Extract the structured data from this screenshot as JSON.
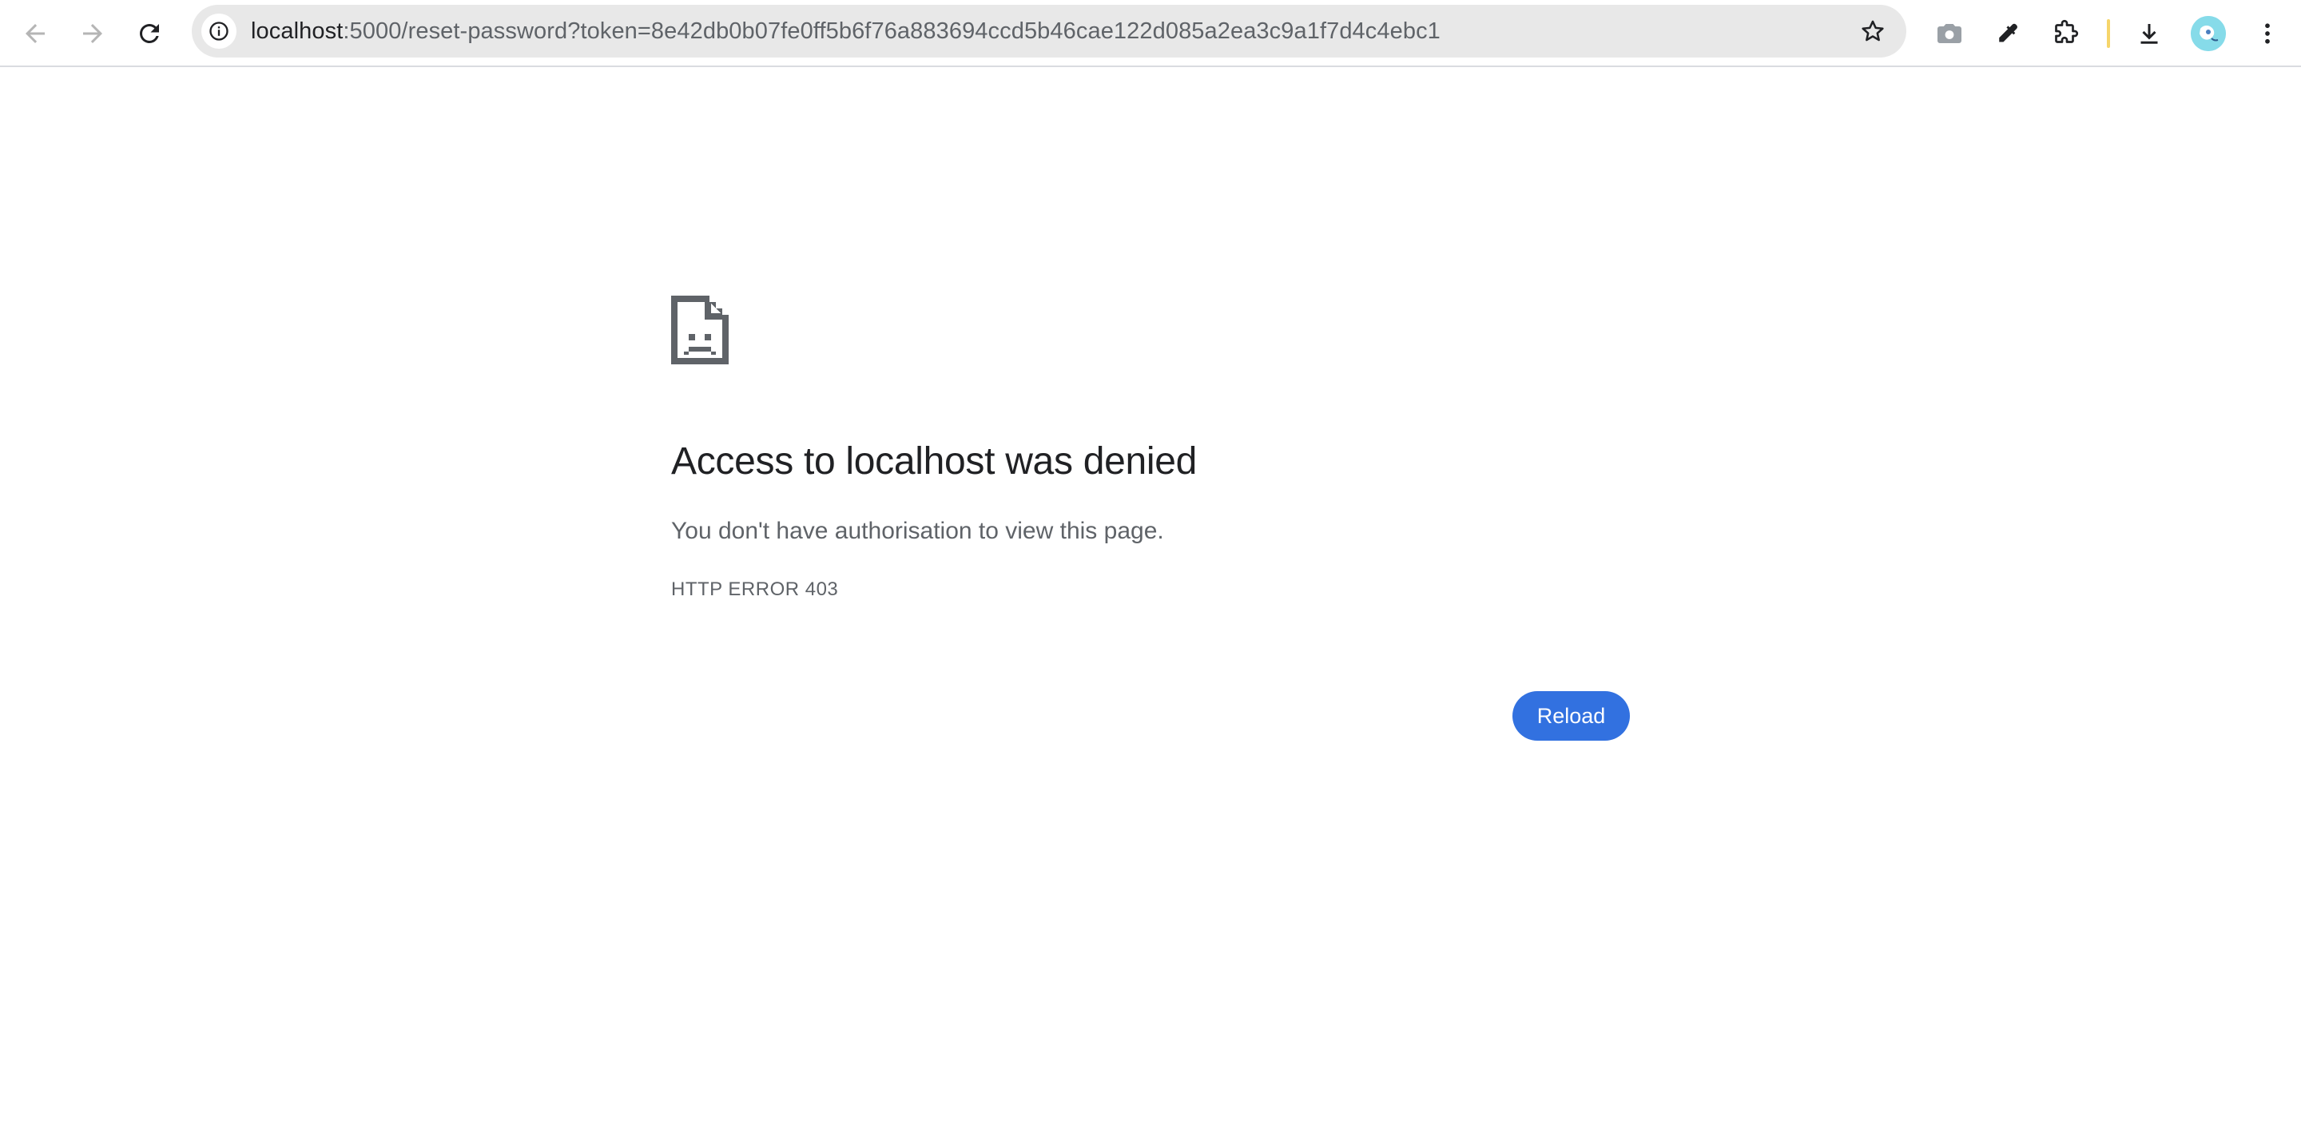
{
  "browser": {
    "url_host": "localhost",
    "url_rest": ":5000/reset-password?token=8e42db0b07fe0ff5b6f76a883694ccd5b46cae122d085a2ea3c9a1f7d4c4ebc1",
    "icons": {
      "back": "arrow-left-icon",
      "forward": "arrow-right-icon",
      "reload": "reload-icon",
      "site_info": "info-icon",
      "bookmark": "star-icon",
      "camera": "camera-icon",
      "eyedropper": "eyedropper-icon",
      "extensions": "puzzle-icon",
      "downloads": "download-icon",
      "profile": "avatar",
      "menu": "kebab-menu-icon"
    }
  },
  "error_page": {
    "icon": "sad-document-icon",
    "headline": "Access to localhost was denied",
    "message": "You don't have authorisation to view this page.",
    "error_code": "HTTP ERROR 403",
    "reload_label": "Reload"
  },
  "colors": {
    "accent": "#3271e0",
    "text_primary": "#202124",
    "text_secondary": "#5f6368",
    "omnibox_bg": "#e8e8e8"
  }
}
